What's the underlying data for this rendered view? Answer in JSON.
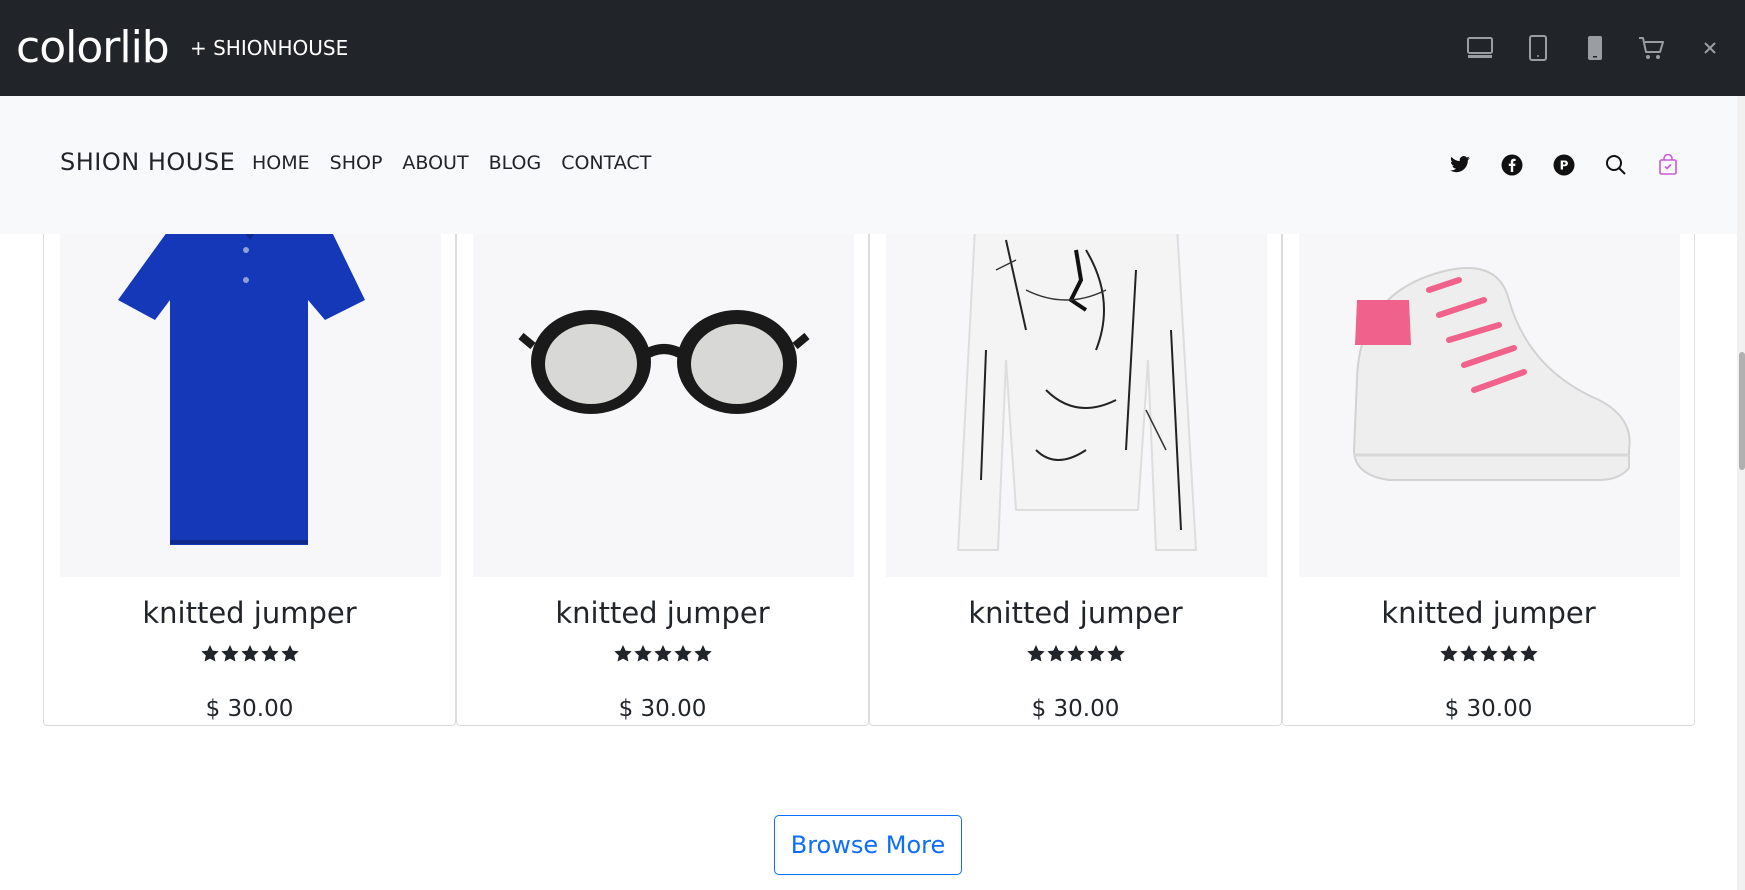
{
  "topbar": {
    "logo": "colorlib",
    "theme_name": "+ SHIONHOUSE",
    "icons": [
      "desktop-icon",
      "tablet-icon",
      "mobile-icon",
      "cart-icon",
      "close-icon"
    ]
  },
  "site": {
    "brand": "SHION HOUSE",
    "menu": [
      "HOME",
      "SHOP",
      "ABOUT",
      "BLOG",
      "CONTACT"
    ],
    "icons": [
      "twitter-icon",
      "facebook-icon",
      "pinterest-icon",
      "search-icon",
      "shopping-bag-icon"
    ],
    "accent": "#c75bd6"
  },
  "products": [
    {
      "title": "knitted jumper",
      "rating": 5,
      "price": "$ 30.00",
      "image": "blue-polo-shirt"
    },
    {
      "title": "knitted jumper",
      "rating": 5,
      "price": "$ 30.00",
      "image": "black-sunglasses"
    },
    {
      "title": "knitted jumper",
      "rating": 5,
      "price": "$ 30.00",
      "image": "paint-splatter-sweater"
    },
    {
      "title": "knitted jumper",
      "rating": 5,
      "price": "$ 30.00",
      "image": "white-pink-sneaker"
    }
  ],
  "browse_more": "Browse More"
}
